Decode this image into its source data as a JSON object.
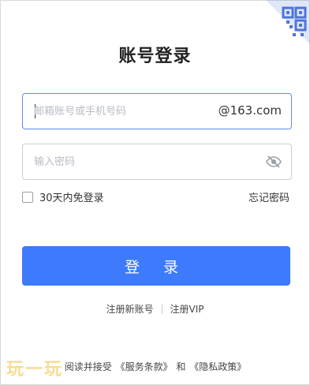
{
  "title": "账号登录",
  "account": {
    "placeholder": "邮箱账号或手机号码",
    "domain_suffix": "@163.com"
  },
  "password": {
    "placeholder": "输入密码",
    "visibility_icon": "eye-slash-icon"
  },
  "remember_label": "30天内免登录",
  "remember_checked": false,
  "forgot_label": "忘记密码",
  "login_label": "登 录",
  "register_label": "注册新账号",
  "vip_label": "注册VIP",
  "agreement": {
    "prefix": "阅读并接受",
    "terms": "《服务条款》",
    "and": "和",
    "privacy": "《隐私政策》"
  },
  "watermark_text": "玩一玩",
  "colors": {
    "primary": "#3d7afc",
    "focus_border": "#5b8de8"
  }
}
